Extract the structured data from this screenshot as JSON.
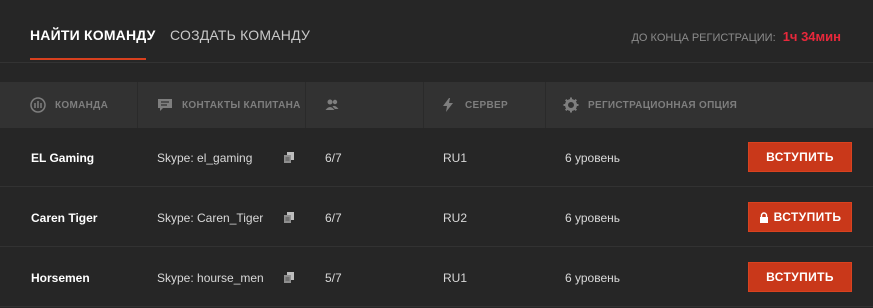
{
  "tabs": [
    {
      "label": "НАЙТИ КОМАНДУ",
      "active": true
    },
    {
      "label": "СОЗДАТЬ КОМАНДУ",
      "active": false
    }
  ],
  "countdown": {
    "label": "ДО КОНЦА РЕГИСТРАЦИИ:",
    "time": "1ч 34мин"
  },
  "columns": [
    {
      "label": "КОМАНДА",
      "icon": "team-emblem-icon"
    },
    {
      "label": "КОНТАКТЫ КАПИТАНА",
      "icon": "chat-icon"
    },
    {
      "label": "",
      "icon": "players-icon"
    },
    {
      "label": "СЕРВЕР",
      "icon": "lightning-icon"
    },
    {
      "label": "РЕГИСТРАЦИОННАЯ ОПЦИЯ",
      "icon": "gear-icon"
    }
  ],
  "rows": [
    {
      "team": "EL Gaming",
      "contact": "Skype: el_gaming",
      "members": "6/7",
      "server": "RU1",
      "option": "6 уровень",
      "button": "ВСТУПИТЬ",
      "locked": false
    },
    {
      "team": "Caren Tiger",
      "contact": "Skype: Caren_Tiger",
      "members": "6/7",
      "server": "RU2",
      "option": "6 уровень",
      "button": "ВСТУПИТЬ",
      "locked": true
    },
    {
      "team": "Horsemen",
      "contact": "Skype: hourse_men",
      "members": "5/7",
      "server": "RU1",
      "option": "6 уровень",
      "button": "ВСТУПИТЬ",
      "locked": false
    }
  ],
  "colors": {
    "accent": "#c9381a",
    "countdown_time": "#e8283b",
    "background": "#262626",
    "header": "#323232"
  }
}
